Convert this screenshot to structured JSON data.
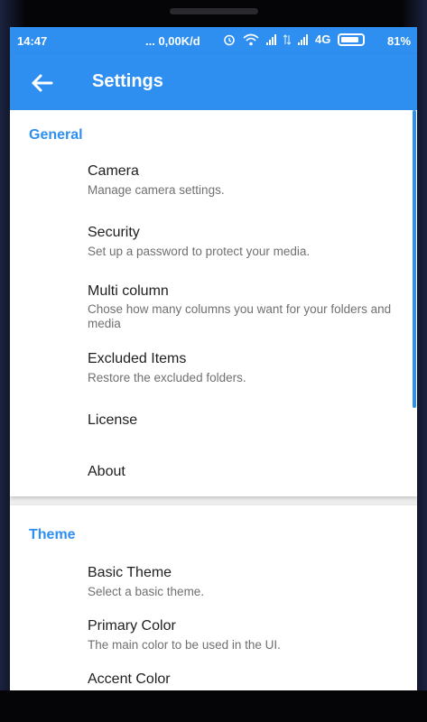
{
  "status_bar": {
    "time": "14:47",
    "speed": "... 0,00K/d",
    "network": "4G",
    "battery_percent": "81%",
    "icons": [
      "alarm-icon",
      "wifi-icon",
      "signal-icon",
      "data-icon",
      "signal-icon",
      "battery-icon"
    ]
  },
  "app_bar": {
    "back_icon": "arrow-left-icon",
    "title": "Settings",
    "color": "#2f8ff0"
  },
  "general": {
    "title": "General",
    "items": [
      {
        "title": "Camera",
        "subtitle": "Manage camera settings."
      },
      {
        "title": "Security",
        "subtitle": "Set up a password to protect your media."
      },
      {
        "title": "Multi column",
        "subtitle": "Chose how many columns you want for your folders and media"
      },
      {
        "title": "Excluded Items",
        "subtitle": "Restore the excluded folders."
      },
      {
        "title": "License",
        "subtitle": ""
      },
      {
        "title": "About",
        "subtitle": ""
      }
    ]
  },
  "theme": {
    "title": "Theme",
    "items": [
      {
        "title": "Basic Theme",
        "subtitle": "Select a basic theme."
      },
      {
        "title": "Primary Color",
        "subtitle": "The main color to be used in the UI."
      },
      {
        "title": "Accent Color",
        "subtitle": ""
      }
    ]
  }
}
